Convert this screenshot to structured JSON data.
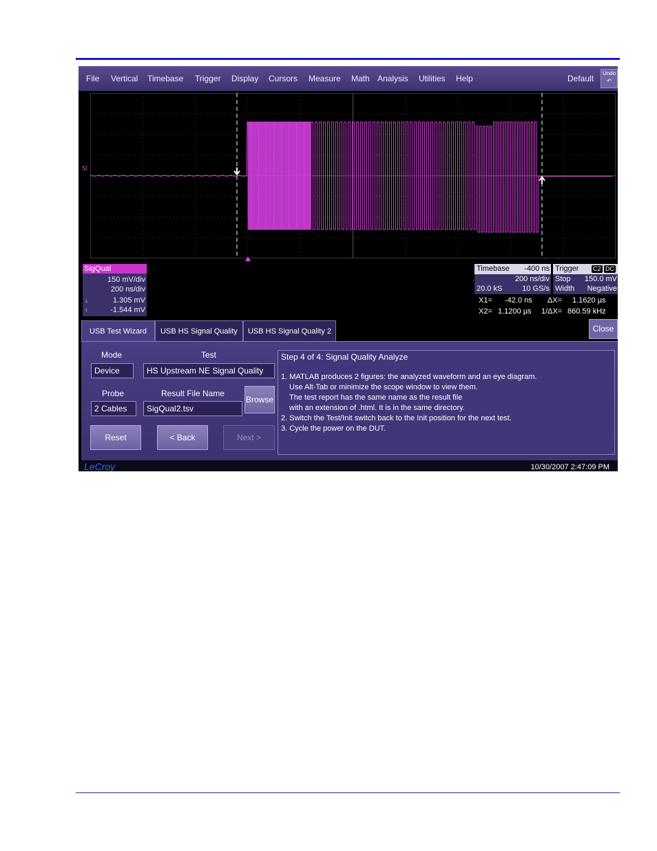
{
  "menubar": {
    "items": [
      "File",
      "Vertical",
      "Timebase",
      "Trigger",
      "Display",
      "Cursors",
      "Measure",
      "Math",
      "Analysis",
      "Utilities",
      "Help"
    ],
    "default_label": "Default",
    "undo_label": "Undo"
  },
  "trace": {
    "label": "SI",
    "color": "#d23fdc"
  },
  "descriptor": {
    "name": "SigQual",
    "vdiv": "150 mV/div",
    "tdiv": "200 ns/div",
    "cursor1": "1.305 mV",
    "cursor2": "-1.544 mV"
  },
  "timebase": {
    "title": "Timebase",
    "delay": "-400 ns",
    "per_div": "200 ns/div",
    "samples": "20.0 kS",
    "rate": "10 GS/s"
  },
  "trigger": {
    "title": "Trigger",
    "badge1": "C2",
    "badge2": "DC",
    "mode": "Stop",
    "level": "150.0 mV",
    "type": "Width",
    "slope": "Negative"
  },
  "cursors": {
    "x1_label": "X1=",
    "x1_value": "-42.0 ns",
    "dx_label": "ΔX=",
    "dx_value": "1.1620 µs",
    "x2_label": "X2=",
    "x2_value": "1.1200 µs",
    "inv_label": "1/ΔX=",
    "inv_value": "860.59 kHz"
  },
  "tabs": [
    "USB Test Wizard",
    "USB HS Signal Quality",
    "USB HS Signal Quality 2"
  ],
  "close_label": "Close",
  "form": {
    "mode_label": "Mode",
    "mode_value": "Device",
    "test_label": "Test",
    "test_value": "HS Upstream NE Signal Quality",
    "probe_label": "Probe",
    "probe_value": "2 Cables",
    "file_label": "Result File Name",
    "file_value": "SigQual2.tsv",
    "browse_label": "Browse",
    "reset_label": "Reset",
    "back_label": "< Back",
    "next_label": "Next >"
  },
  "info": {
    "title": "Step  4 of  4: Signal Quality Analyze",
    "lines": [
      "1. MATLAB produces 2 figures: the analyzed waveform and an eye diagram.",
      "Use Alt-Tab or minimize the scope window to view them.",
      "The test report has the same name as the result file",
      "with an extension of .html.  It is in the same directory.",
      "2. Switch the Test/Init switch back to the Init position for the next test.",
      "3. Cycle the power on the DUT."
    ]
  },
  "status": {
    "logo": "LeCroy",
    "datetime": "10/30/2007 2:47:09 PM"
  }
}
